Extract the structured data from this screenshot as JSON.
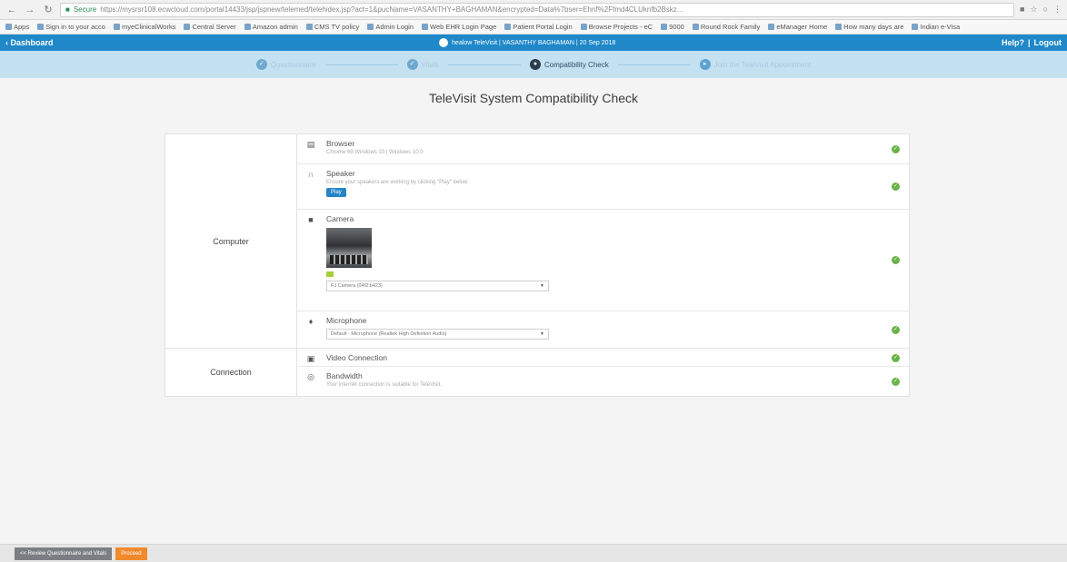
{
  "browser": {
    "secure_label": "Secure",
    "url": "https://mysrsr108.ecwcloud.com/portal14433/jsp/jspnew/telemed/telehidex.jsp?act=1&pucName=VASANTHY+BAGHAMAN&encrypted=Data%7bser=Ehnf%2Ffmd4CLUknfb2Bskz..."
  },
  "bookmarks": [
    "Apps",
    "Sign in to your acco",
    "myeClinicalWorks",
    "Central Server",
    "Amazon admin",
    "CMS TV policy",
    "Admin Login",
    "Web EHR Login Page",
    "Patient Portal Login",
    "Browse Projects - eC",
    "9000",
    "Round Rock Family",
    "eManager Home",
    "How many days are",
    "Indian e-Visa"
  ],
  "header": {
    "back_label": "‹ Dashboard",
    "center_text": "healow TeleVisit | VASANTHY BAGHAMAN | 20 Sep 2018",
    "help_label": "Help?",
    "separator": "|",
    "logout_label": "Logout"
  },
  "steps": [
    {
      "label": "Questionnaire",
      "state": "done"
    },
    {
      "label": "Vitals",
      "state": "done"
    },
    {
      "label": "Compatibility Check",
      "state": "active"
    },
    {
      "label": "Join the TeleVisit Appointment",
      "state": "pending"
    }
  ],
  "page": {
    "title": "TeleVisit System Compatibility Check"
  },
  "computer": {
    "label": "Computer",
    "browser": {
      "title": "Browser",
      "sub": "Chrome 69 Windows 10 | Windows 10.0"
    },
    "speaker": {
      "title": "Speaker",
      "sub": "Ensure your speakers are working by clicking \"Play\" below.",
      "play_label": "Play"
    },
    "camera": {
      "title": "Camera",
      "selected": "FJ Camera (04f2:b423)"
    },
    "microphone": {
      "title": "Microphone",
      "selected": "Default - Microphone (Realtek High Definition Audio)"
    }
  },
  "connection": {
    "label": "Connection",
    "video": {
      "title": "Video Connection"
    },
    "bandwidth": {
      "title": "Bandwidth",
      "sub": "Your internet connection is suitable for TeleVisit."
    }
  },
  "footer": {
    "review_label": "<< Review Questionnaire and Vitals",
    "proceed_label": "Proceed"
  },
  "colors": {
    "header": "#1e88c9",
    "stepper": "#c4e1f2",
    "ok": "#6bb24a",
    "proceed": "#f08a2c"
  }
}
